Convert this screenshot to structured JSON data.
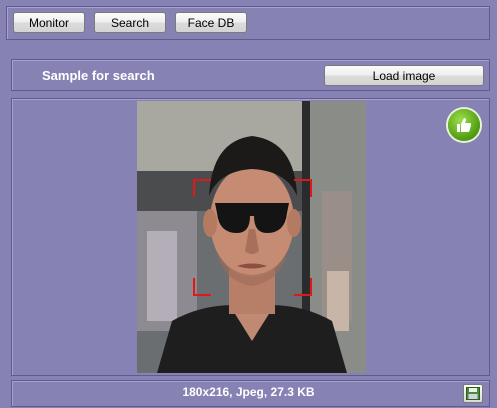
{
  "toolbar": {
    "monitor_label": "Monitor",
    "search_label": "Search",
    "facedb_label": "Face DB"
  },
  "search": {
    "sample_label": "Sample for search",
    "load_button_label": "Load image"
  },
  "image": {
    "info": "180x216, Jpeg, 27.3 KB",
    "status_icon": "thumbs-up-icon",
    "save_icon": "save-icon"
  },
  "colors": {
    "background": "#8682b4",
    "face_box": "#e01818",
    "status_ok": "#4f9a12"
  }
}
